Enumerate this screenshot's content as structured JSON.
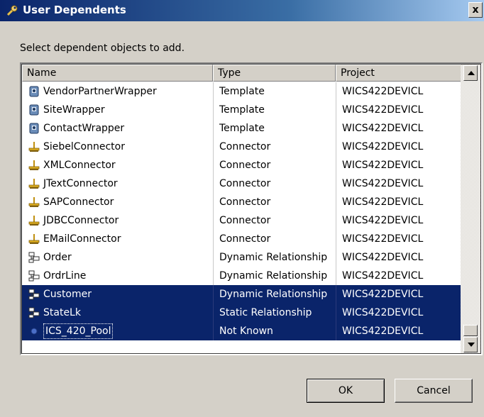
{
  "window": {
    "title": "User Dependents",
    "title_icon": "wrench-icon",
    "close_label": "x"
  },
  "instruction": "Select dependent objects to add.",
  "table": {
    "columns": [
      "Name",
      "Type",
      "Project"
    ],
    "rows": [
      {
        "name": "VendorPartnerWrapper",
        "type": "Template",
        "project": "WICS422DEVICL",
        "icon": "template-icon",
        "selected": false
      },
      {
        "name": "SiteWrapper",
        "type": "Template",
        "project": "WICS422DEVICL",
        "icon": "template-icon",
        "selected": false
      },
      {
        "name": "ContactWrapper",
        "type": "Template",
        "project": "WICS422DEVICL",
        "icon": "template-icon",
        "selected": false
      },
      {
        "name": "SiebelConnector",
        "type": "Connector",
        "project": "WICS422DEVICL",
        "icon": "connector-icon",
        "selected": false
      },
      {
        "name": "XMLConnector",
        "type": "Connector",
        "project": "WICS422DEVICL",
        "icon": "connector-icon",
        "selected": false
      },
      {
        "name": "JTextConnector",
        "type": "Connector",
        "project": "WICS422DEVICL",
        "icon": "connector-icon",
        "selected": false
      },
      {
        "name": "SAPConnector",
        "type": "Connector",
        "project": "WICS422DEVICL",
        "icon": "connector-icon",
        "selected": false
      },
      {
        "name": "JDBCConnector",
        "type": "Connector",
        "project": "WICS422DEVICL",
        "icon": "connector-icon",
        "selected": false
      },
      {
        "name": "EMailConnector",
        "type": "Connector",
        "project": "WICS422DEVICL",
        "icon": "connector-icon",
        "selected": false
      },
      {
        "name": "Order",
        "type": "Dynamic Relationship",
        "project": "WICS422DEVICL",
        "icon": "relationship-icon",
        "selected": false
      },
      {
        "name": "OrdrLine",
        "type": "Dynamic Relationship",
        "project": "WICS422DEVICL",
        "icon": "relationship-icon",
        "selected": false
      },
      {
        "name": "Customer",
        "type": "Dynamic Relationship",
        "project": "WICS422DEVICL",
        "icon": "relationship-icon",
        "selected": true
      },
      {
        "name": "StateLk",
        "type": "Static Relationship",
        "project": "WICS422DEVICL",
        "icon": "relationship-icon",
        "selected": true
      },
      {
        "name": "ICS_420_Pool",
        "type": "Not Known",
        "project": "WICS422DEVICL",
        "icon": "pool-dot-icon",
        "selected": true,
        "focused": true
      }
    ]
  },
  "buttons": {
    "ok": "OK",
    "cancel": "Cancel"
  },
  "colors": {
    "selection": "#0a246a",
    "titlebar": "#0a246a",
    "dialog_bg": "#d4d0c8"
  }
}
